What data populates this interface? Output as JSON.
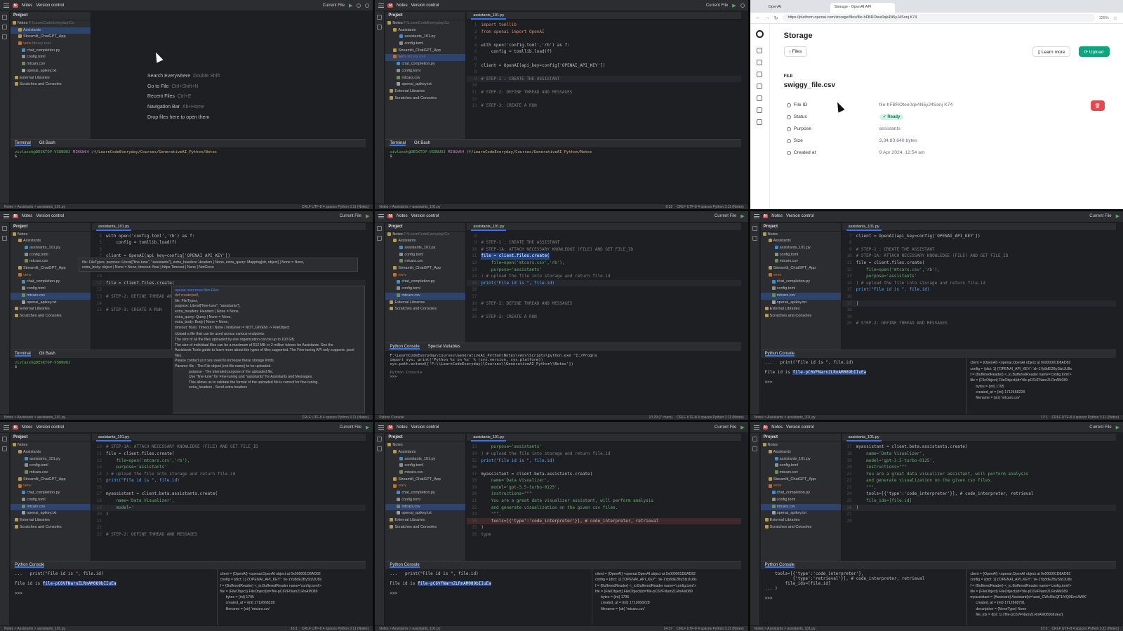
{
  "ide": {
    "project": "Notes",
    "version_control": "Version control",
    "run_config": "Current File",
    "project_label": "Project",
    "tree": {
      "root": "Notes",
      "root_path": "F:\\LearnCodeEveryday\\Co",
      "assistants": "Assistants",
      "assistants_file": "assistants_101.py",
      "config": "config.toml",
      "mtcars": "mtcars.csv",
      "streamlit": "Streamlit_ChatGPT_App",
      "venv": "venv",
      "venv_note": "library root",
      "chat": "chat_completion.py",
      "apikey": "openai_apikey.txt",
      "ext": "External Libraries",
      "scratch": "Scratches and Consoles"
    },
    "tab_file": "assistants_101.py",
    "terminal_tab": "Terminal",
    "gitbash_tab": "Git Bash",
    "console_tab": "Python Console",
    "prompt_user": "vivlaxsh@DESKTOP-VSONUOJ",
    "prompt_env": "MINGW64",
    "prompt_path": "/f/LearnCodeEveryday/Courses/GenerativeAI_Python/Notes",
    "status_path": "Notes > Assistants > assistants_101.py",
    "status_right": "CRLF  UTF-8  4 spaces  Python 3.11 (Notes)",
    "status_pos_1": "8:32",
    "status_pos_2": "10:29 (7 chars)",
    "status_pos_3": "17:1",
    "status_pos_4": "16:1",
    "status_pos_5": "24:37",
    "status_pos_6": "27:2",
    "welcome": {
      "search": "Search Everywhere",
      "search_k": "Double Shift",
      "goto": "Go to File",
      "goto_k": "Ctrl+Shift+N",
      "recent": "Recent Files",
      "recent_k": "Ctrl+E",
      "nav": "Navigation Bar",
      "nav_k": "Alt+Home",
      "drop": "Drop files here to open them"
    },
    "code": {
      "l1": "import tomllib",
      "l2": "from openai import OpenAI",
      "l4": "with open('config.toml','rb') as f:",
      "l5": "    config = tomllib.load(f)",
      "l7": "client = OpenAI(api_key=config['OPENAI_API_KEY'])",
      "l9": "# STEP-1 : CREATE THE ASSISTANT",
      "l10": "# STEP-1A: ATTACH NECESSARY KNOWLEDGE (FILE) AND GET FILE_ID",
      "l11": "file = client.files.create(",
      "l12": "    file=open('mtcars.csv','rb'),",
      "l13": "    purpose='assistants'",
      "l14": ") # upload the file into storage and return file.id",
      "l15": "print(\"File id is \", file.id)",
      "l16": "# STEP-2: DEFINE THREAD AND MESSAGES",
      "l17": "# STEP-3: CREATE A RUN",
      "l18": "myassistant = client.beta.assistants.create(",
      "l19": "    name='Data Visualizer',",
      "l20": "    model='gpt-3.5-turbo-0125',",
      "l21": "    instructions=\"\"\"",
      "l22": "    You are a great data visualizer assistant, will perform analysis",
      "l23": "    and generate visualization on the given csv files.",
      "l24": "    \"\"\",",
      "l25": "    tools=[{'type':'code_interpreter'}], # code_interpreter, retrieval",
      "l26": "    file_ids=[file.id]",
      "l27": ")",
      "l28": "    tools=[{'type':'code_interpreter'},",
      "l29": "           {'type':'retrieval'}], # code_interpreter, retrieval",
      "l30": "    model='",
      "l31": "type"
    },
    "console": {
      "run": "F:\\LearnCodeEveryday\\Courses\\GenerativeAI_Python\\Notes\\venv\\Scripts\\python.exe \"I:/Progra",
      "imp": "import sys; print('Python %s on %s' % (sys.version, sys.platform))",
      "ext": "sys.path.extend(['F:\\\\LearnCodeEveryday\\\\Courses\\\\GenerativeAI_Python\\\\Notes'])",
      "pc": "Python Console",
      "special": "Special Variables",
      "print": "...   print(\"File id is \", file.id)",
      "fileid_pre": "File id is ",
      "fileid": "file-pC6VFNarnZLRnAM089bIIuEa",
      "prompt": ">>>",
      "v1": "client = {OpenAI} <openai.OpenAI object at 0x000001D8AD82",
      "v2": "config = {dict: 1} {'OPENAI_API_KEY': 'sk-1Yp8dE2ByStzUU8s",
      "v3": "f = {BufferedReader} <_io.BufferedReader name='config.toml'>",
      "v4": "file = {FileObject} FileObject(id='file-pC6VFNarnZLRnAM089",
      "v5": "bytes = {int} 1795",
      "v6": "created_at = {int} 1712668228",
      "v7": "filename = {str} 'mtcars.csv'",
      "v8": "myassistant = {Assistant} Assistant(id='asst_CWxl6tcQF1tVQ9EmLW8K'",
      "v9": "created_at = {int} 1712668791",
      "v10": "description = {NoneType} None",
      "v11": "file_ids = {list: 1} ['file-pC6VFNarnZLRnAM089bIIuEa']"
    },
    "popup": {
      "sig": "file: FileTypes, purpose: Literal[\"fine-tune\", \"assistants\"], extra_headers: Headers | None, extra_query: Mapping[str, object] | None = None,",
      "sig2": "extra_body: object | None = None, timeout: float | httpx.Timeout | None | NotGiven",
      "doc_head": "openai.resources.files.Files",
      "def": "def create(self,",
      "d1": "    file: FileTypes,",
      "d2": "    purpose: Literal[\"fine-tune\", \"assistants\"],",
      "d3": "    extra_headers: Headers | None = None,",
      "d4": "    extra_query: Query | None = None,",
      "d5": "    extra_body: Body | None = None,",
      "d6": "    timeout: float | Timeout | None | NotGiven = NOT_GIVEN) -> FileObject",
      "t1": "Upload a file that can be used across various endpoints.",
      "t2": "The size of all the files uploaded by one organization can be up to 100 GB.",
      "t3": "The size of individual files can be a maximum of 512 MB or 2 million tokens for Assistants. See the",
      "t4": "Assistants Tools guide to learn more about the types of files supported. The Fine-tuning API only supports .jsonl files.",
      "t5": "Please contact us if you need to increase these storage limits.",
      "t6": "Params: file - The File object (not file name) to be uploaded.",
      "t7": "purpose - The intended purpose of the uploaded file.",
      "t8": "Use \"fine-tune\" for Fine-tuning and \"assistants\" for Assistants and Messages.",
      "t9": "This allows us to validate the format of the uploaded file is correct for fine-tuning.",
      "t10": "extra_headers - Send extra headers"
    }
  },
  "browser": {
    "tab1": "OpenAI",
    "tab2": "Storage - OpenAI API",
    "url": "https://platform.openai.com/storage/files/file-hFBROtee0qk4N5yJ4Sonj K74",
    "zoom": "125%",
    "title": "Storage",
    "back": "Files",
    "learn": "Learn more",
    "upload": "Upload",
    "file_label": "FILE",
    "file_name": "swiggy_file.csv",
    "rows": [
      {
        "label": "File ID",
        "value": "file-hFBROtee0qk4N5yJ4Sonj K74"
      },
      {
        "label": "Status",
        "value": "Ready"
      },
      {
        "label": "Purpose",
        "value": "assistants"
      },
      {
        "label": "Size",
        "value": "3,34,83,640 bytes"
      },
      {
        "label": "Created at",
        "value": "9 Apr 2024, 12:54 am"
      }
    ],
    "delete_icon": "trash-icon"
  }
}
